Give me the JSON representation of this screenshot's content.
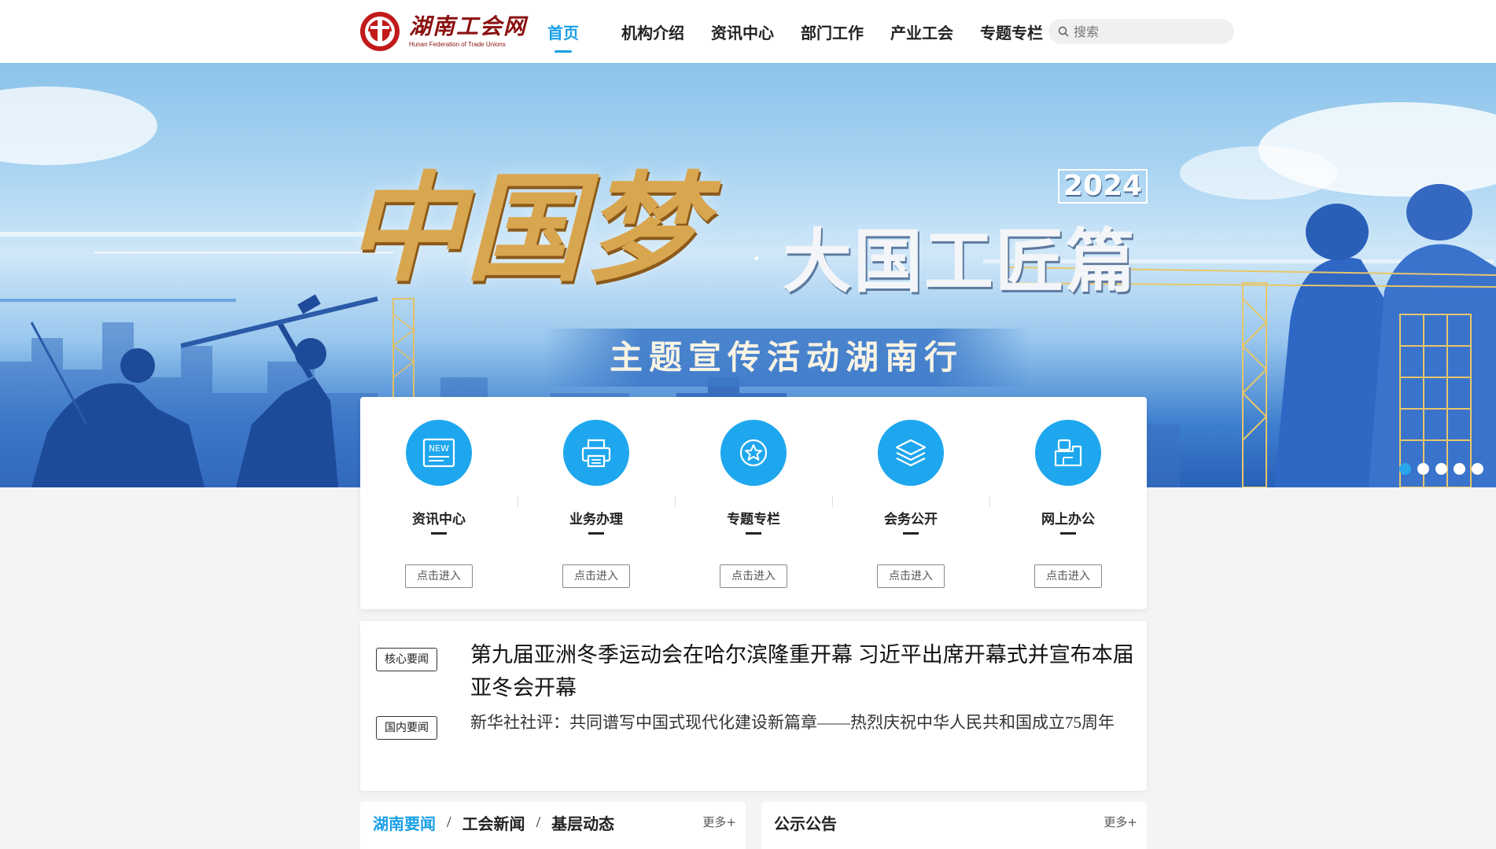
{
  "logo": {
    "cn": "湖南工会网",
    "en": "Hunan Federation of Trade Unions"
  },
  "nav": [
    {
      "label": "首页"
    },
    {
      "label": "机构介绍"
    },
    {
      "label": "资讯中心"
    },
    {
      "label": "部门工作"
    },
    {
      "label": "产业工会"
    },
    {
      "label": "专题专栏"
    }
  ],
  "search": {
    "placeholder": "搜索",
    "icon": "search-icon"
  },
  "banner": {
    "title": "中国梦",
    "dot": "·",
    "subtitle": "大国工匠篇",
    "year": "2024",
    "tagline": "主题宣传活动湖南行",
    "slides_total": 5,
    "slide_active": 1
  },
  "quick": [
    {
      "label": "资讯中心",
      "button": "点击进入",
      "icon": "new-icon"
    },
    {
      "label": "业务办理",
      "button": "点击进入",
      "icon": "printer-icon"
    },
    {
      "label": "专题专栏",
      "button": "点击进入",
      "icon": "star-badge-icon"
    },
    {
      "label": "会务公开",
      "button": "点击进入",
      "icon": "layers-icon"
    },
    {
      "label": "网上办公",
      "button": "点击进入",
      "icon": "office-icon"
    }
  ],
  "headlines": [
    {
      "tag": "核心要闻",
      "text": "第九届亚洲冬季运动会在哈尔滨隆重开幕 习近平出席开幕式并宣布本届亚冬会开幕"
    },
    {
      "tag": "国内要闻",
      "text": "新华社社评：共同谱写中国式现代化建设新篇章——热烈庆祝中华人民共和国成立75周年"
    }
  ],
  "panel_left": {
    "tabs": [
      "湖南要闻",
      "工会新闻",
      "基层动态"
    ],
    "separator": "/",
    "more": "更多+"
  },
  "panel_right": {
    "title": "公示公告",
    "more": "更多+"
  },
  "colors": {
    "accent": "#1aa0e6",
    "icon_bg": "#1ea7ee",
    "logo_red": "#8a1010"
  }
}
